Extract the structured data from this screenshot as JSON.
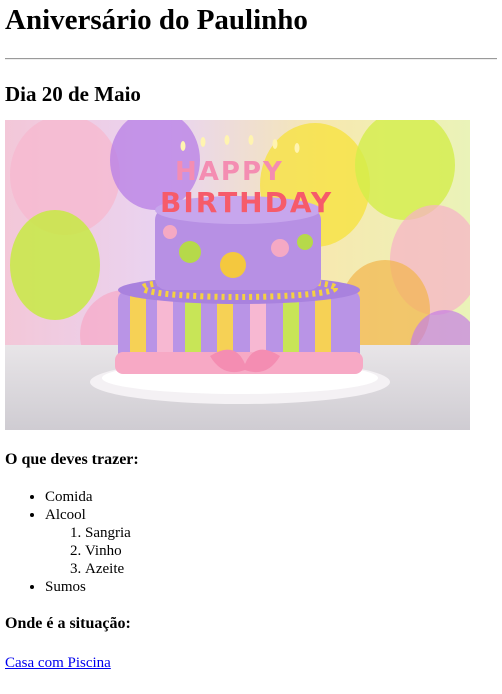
{
  "title": "Aniversário do Paulinho",
  "date": "Dia 20 de Maio",
  "image": {
    "icon": "birthday-cake-photo",
    "topper_text": [
      "HAPPY",
      "BIRTHDAY"
    ]
  },
  "bring": {
    "heading": "O que deves trazer:",
    "items": [
      "Comida",
      "Alcool",
      "Sumos"
    ],
    "alcohol_options": [
      "Sangria",
      "Vinho",
      "Azeite"
    ]
  },
  "location": {
    "heading": "Onde é a situação:",
    "link_text": "Casa com Piscina"
  }
}
